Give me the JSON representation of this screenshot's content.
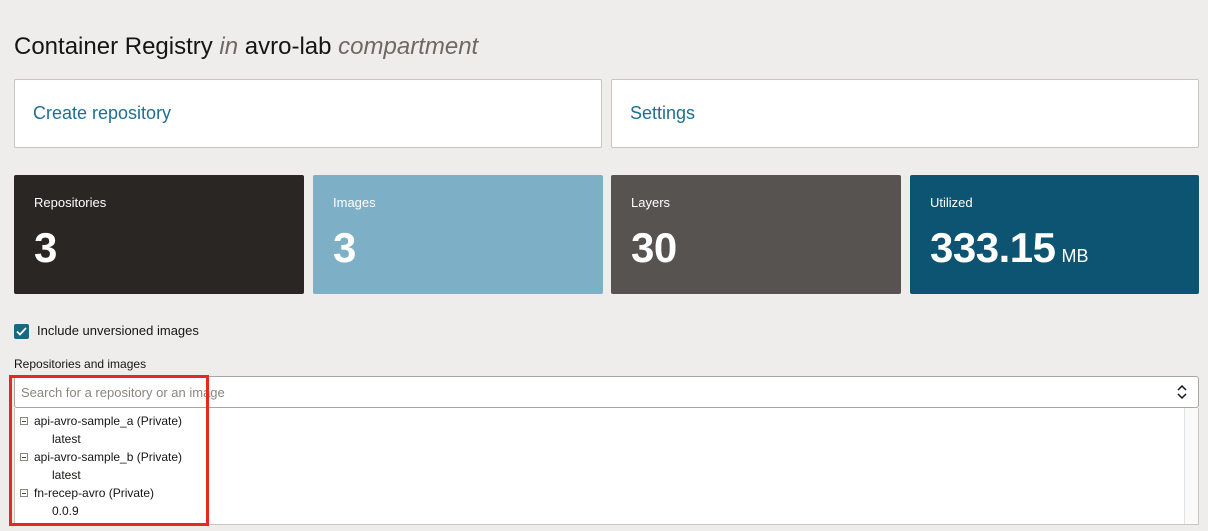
{
  "header": {
    "title_main": "Container Registry",
    "title_in": "in",
    "compartment_name": "avro-lab",
    "title_compartment": "compartment"
  },
  "actions": {
    "create_label": "Create repository",
    "settings_label": "Settings"
  },
  "stats": {
    "repositories": {
      "label": "Repositories",
      "value": "3"
    },
    "images": {
      "label": "Images",
      "value": "3"
    },
    "layers": {
      "label": "Layers",
      "value": "30"
    },
    "utilized": {
      "label": "Utilized",
      "value": "333.15",
      "unit": "MB"
    }
  },
  "filters": {
    "include_unversioned_label": "Include unversioned images",
    "include_unversioned_checked": true
  },
  "repositories_section": {
    "label": "Repositories and images",
    "search_placeholder": "Search for a repository or an image",
    "tree": [
      {
        "name": "api-avro-sample_a (Private)",
        "tags": [
          "latest"
        ]
      },
      {
        "name": "api-avro-sample_b (Private)",
        "tags": [
          "latest"
        ]
      },
      {
        "name": "fn-recep-avro (Private)",
        "tags": [
          "0.0.9"
        ]
      }
    ]
  },
  "colors": {
    "link": "#1f6f8f",
    "repos_tile": "#2a2623",
    "images_tile": "#7db0c7",
    "layers_tile": "#575350",
    "utilized_tile": "#0c5472",
    "highlight": "#e8281f"
  }
}
